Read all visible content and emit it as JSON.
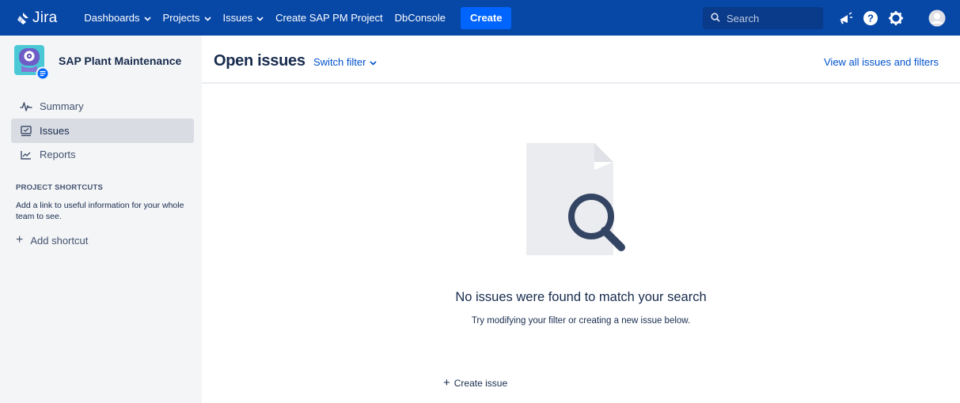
{
  "app": {
    "logo_text": "Jira",
    "nav": [
      {
        "label": "Dashboards",
        "has_dropdown": true
      },
      {
        "label": "Projects",
        "has_dropdown": true
      },
      {
        "label": "Issues",
        "has_dropdown": true
      },
      {
        "label": "Create SAP PM Project",
        "has_dropdown": false
      },
      {
        "label": "DbConsole",
        "has_dropdown": false
      }
    ],
    "create_label": "Create",
    "search_placeholder": "Search",
    "icons": [
      "search-icon",
      "notifications-megaphone-icon",
      "help-icon",
      "settings-gear-icon",
      "user-avatar-icon"
    ]
  },
  "sidebar": {
    "project_name": "SAP Plant Maintenance",
    "items": [
      {
        "label": "Summary",
        "icon": "summary-pulse-icon",
        "selected": false
      },
      {
        "label": "Issues",
        "icon": "issues-icon",
        "selected": true
      },
      {
        "label": "Reports",
        "icon": "reports-chart-icon",
        "selected": false
      }
    ],
    "shortcuts_title": "PROJECT SHORTCUTS",
    "shortcuts_help": "Add a link to useful information for your whole team to see.",
    "add_shortcut": "Add shortcut"
  },
  "main": {
    "title": "Open issues",
    "switch_filter": "Switch filter",
    "view_all": "View all issues and filters",
    "empty_title": "No issues were found to match your search",
    "empty_subtitle": "Try modifying your filter or creating a new issue below.",
    "create_issue": "Create issue"
  },
  "colors": {
    "nav_bg": "#0747a6",
    "create_btn": "#0065ff",
    "link": "#0052cc",
    "sidebar_bg": "#f4f5f7",
    "selected_bg": "#d9dce2"
  }
}
